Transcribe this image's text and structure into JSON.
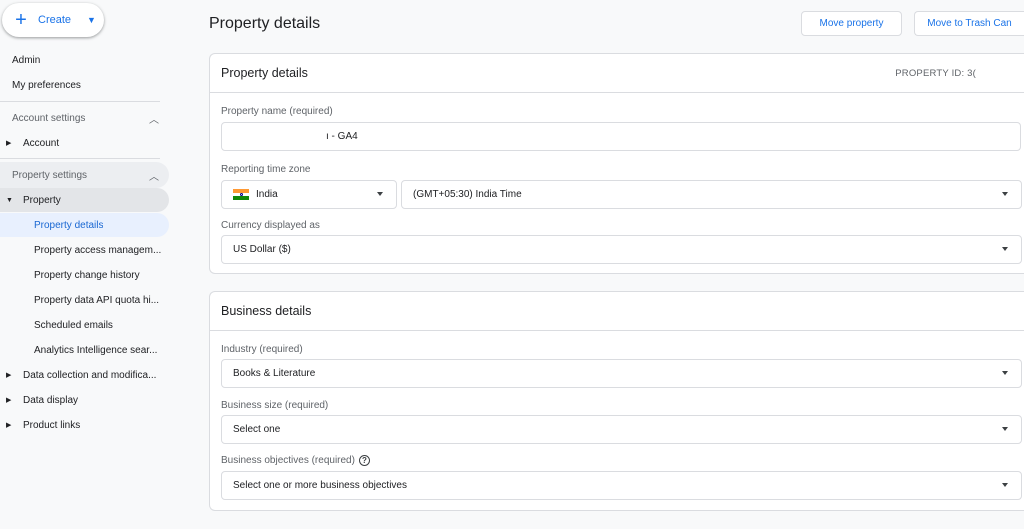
{
  "sidebar": {
    "create_label": "Create",
    "admin": "Admin",
    "my_preferences": "My preferences",
    "account_settings": "Account settings",
    "account": "Account",
    "property_settings": "Property settings",
    "property": "Property",
    "property_sub": [
      "Property details",
      "Property access managem...",
      "Property change history",
      "Property data API quota hi...",
      "Scheduled emails",
      "Analytics Intelligence sear..."
    ],
    "data_collection": "Data collection and modifica...",
    "data_display": "Data display",
    "product_links": "Product links"
  },
  "header": {
    "title": "Property details",
    "move_property": "Move property",
    "move_to_trash": "Move to Trash Can"
  },
  "property_card": {
    "title": "Property details",
    "property_id": "PROPERTY ID: 3(",
    "name_label": "Property name (required)",
    "name_value": "ı - GA4",
    "timezone_label": "Reporting time zone",
    "country": "India",
    "timezone": "(GMT+05:30) India Time",
    "currency_label": "Currency displayed as",
    "currency": "US Dollar ($)"
  },
  "business_card": {
    "title": "Business details",
    "industry_label": "Industry (required)",
    "industry": "Books & Literature",
    "size_label": "Business size (required)",
    "size": "Select one",
    "objectives_label": "Business objectives (required)",
    "objectives": "Select one or more business objectives"
  },
  "colors": {
    "accent": "#1a73e8",
    "active_bg": "#e8f0fe",
    "border": "#dadce0"
  }
}
